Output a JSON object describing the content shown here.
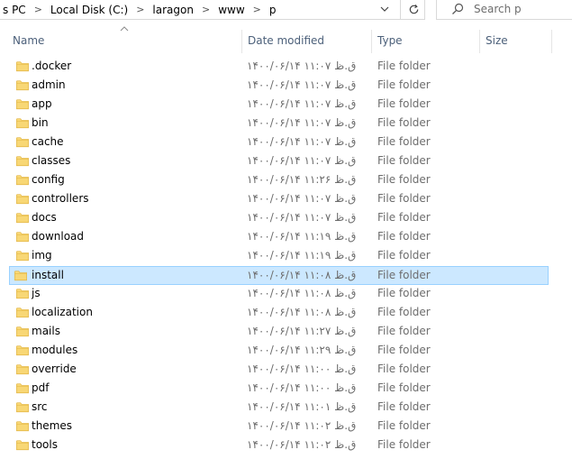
{
  "breadcrumbs": [
    "s PC",
    "Local Disk (C:)",
    "laragon",
    "www",
    "p"
  ],
  "search": {
    "placeholder": "Search p"
  },
  "columns": {
    "name": "Name",
    "date": "Date modified",
    "type": "Type",
    "size": "Size"
  },
  "files": [
    {
      "name": ".docker",
      "date": "۱۴۰۰/۰۶/۱۴ ق.ظ ۱۱:۰۷",
      "type": "File folder"
    },
    {
      "name": "admin",
      "date": "۱۴۰۰/۰۶/۱۴ ق.ظ ۱۱:۰۷",
      "type": "File folder"
    },
    {
      "name": "app",
      "date": "۱۴۰۰/۰۶/۱۴ ق.ظ ۱۱:۰۷",
      "type": "File folder"
    },
    {
      "name": "bin",
      "date": "۱۴۰۰/۰۶/۱۴ ق.ظ ۱۱:۰۷",
      "type": "File folder"
    },
    {
      "name": "cache",
      "date": "۱۴۰۰/۰۶/۱۴ ق.ظ ۱۱:۰۷",
      "type": "File folder"
    },
    {
      "name": "classes",
      "date": "۱۴۰۰/۰۶/۱۴ ق.ظ ۱۱:۰۷",
      "type": "File folder"
    },
    {
      "name": "config",
      "date": "۱۴۰۰/۰۶/۱۴ ق.ظ ۱۱:۲۶",
      "type": "File folder"
    },
    {
      "name": "controllers",
      "date": "۱۴۰۰/۰۶/۱۴ ق.ظ ۱۱:۰۷",
      "type": "File folder"
    },
    {
      "name": "docs",
      "date": "۱۴۰۰/۰۶/۱۴ ق.ظ ۱۱:۰۷",
      "type": "File folder"
    },
    {
      "name": "download",
      "date": "۱۴۰۰/۰۶/۱۴ ق.ظ ۱۱:۱۹",
      "type": "File folder"
    },
    {
      "name": "img",
      "date": "۱۴۰۰/۰۶/۱۴ ق.ظ ۱۱:۱۹",
      "type": "File folder"
    },
    {
      "name": "install",
      "date": "۱۴۰۰/۰۶/۱۴ ق.ظ ۱۱:۰۸",
      "type": "File folder",
      "selected": true
    },
    {
      "name": "js",
      "date": "۱۴۰۰/۰۶/۱۴ ق.ظ ۱۱:۰۸",
      "type": "File folder"
    },
    {
      "name": "localization",
      "date": "۱۴۰۰/۰۶/۱۴ ق.ظ ۱۱:۰۸",
      "type": "File folder"
    },
    {
      "name": "mails",
      "date": "۱۴۰۰/۰۶/۱۴ ق.ظ ۱۱:۲۷",
      "type": "File folder"
    },
    {
      "name": "modules",
      "date": "۱۴۰۰/۰۶/۱۴ ق.ظ ۱۱:۲۹",
      "type": "File folder"
    },
    {
      "name": "override",
      "date": "۱۴۰۰/۰۶/۱۴ ق.ظ ۱۱:۰۰",
      "type": "File folder"
    },
    {
      "name": "pdf",
      "date": "۱۴۰۰/۰۶/۱۴ ق.ظ ۱۱:۰۰",
      "type": "File folder"
    },
    {
      "name": "src",
      "date": "۱۴۰۰/۰۶/۱۴ ق.ظ ۱۱:۰۱",
      "type": "File folder"
    },
    {
      "name": "themes",
      "date": "۱۴۰۰/۰۶/۱۴ ق.ظ ۱۱:۰۲",
      "type": "File folder"
    },
    {
      "name": "tools",
      "date": "۱۴۰۰/۰۶/۱۴ ق.ظ ۱۱:۰۲",
      "type": "File folder"
    }
  ],
  "icons": {
    "folder": "folder-icon",
    "search": "search-icon",
    "refresh": "refresh-icon",
    "chevron": "chevron-right-icon",
    "dropdown": "chevron-down-icon",
    "sort": "sort-ascending-icon"
  },
  "colors": {
    "selection": "#cce8ff",
    "selection_border": "#99d1ff",
    "header_text": "#4c607a",
    "folder": "#f8d775"
  }
}
